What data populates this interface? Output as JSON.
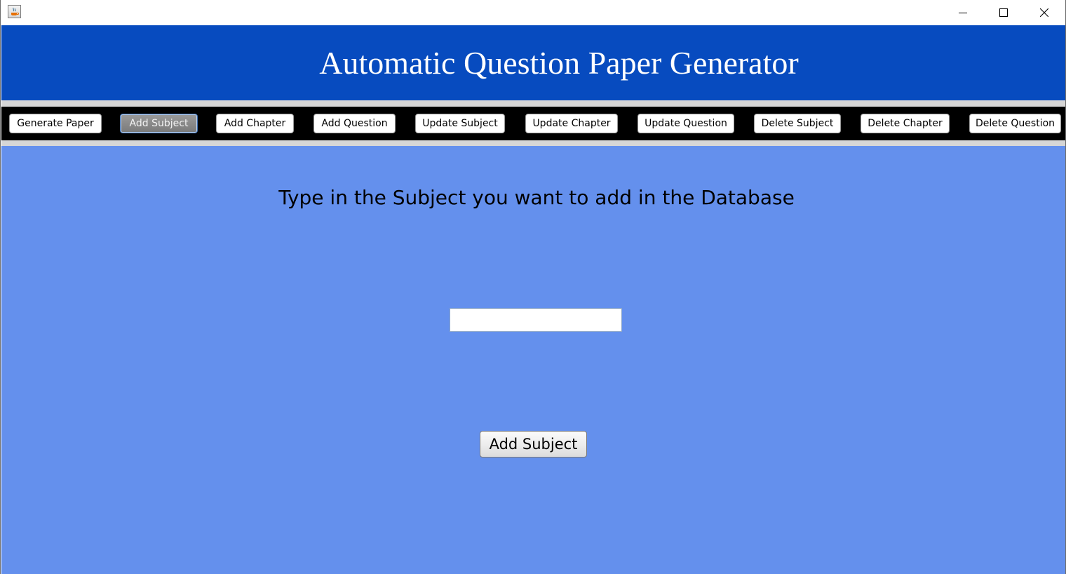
{
  "window": {
    "controls": [
      "minimize-icon",
      "maximize-icon",
      "close-icon"
    ]
  },
  "header": {
    "title": "Automatic Question Paper Generator"
  },
  "nav": {
    "items": [
      {
        "label": "Generate Paper"
      },
      {
        "label": "Add Subject",
        "active": true
      },
      {
        "label": "Add Chapter"
      },
      {
        "label": "Add Question"
      },
      {
        "label": "Update Subject"
      },
      {
        "label": "Update Chapter"
      },
      {
        "label": "Update Question"
      },
      {
        "label": "Delete Subject"
      },
      {
        "label": "Delete Chapter"
      },
      {
        "label": "Delete Question"
      }
    ]
  },
  "main": {
    "prompt": "Type in the Subject you want to add in the Database",
    "subject_input": {
      "value": "",
      "placeholder": ""
    },
    "submit_label": "Add Subject"
  },
  "colors": {
    "banner": "#074bbf",
    "content": "#6490ed",
    "nav_bar": "#000000"
  }
}
